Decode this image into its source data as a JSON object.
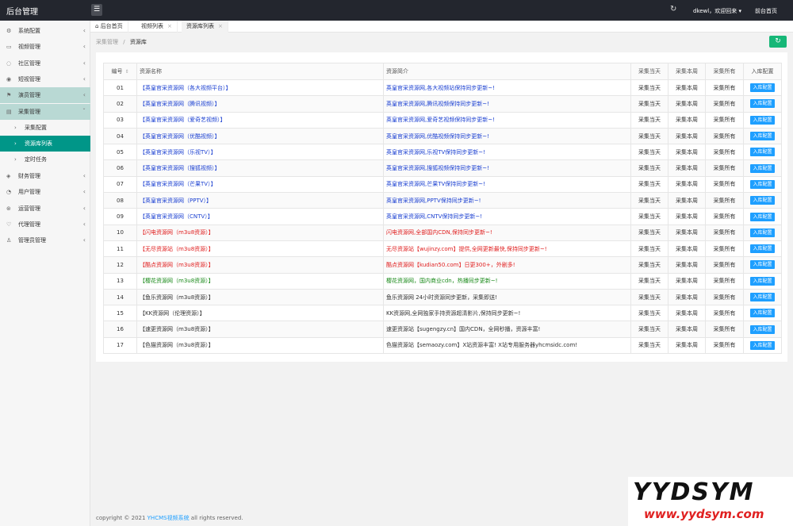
{
  "app": {
    "title": "后台管理"
  },
  "topbar": {
    "user": "dkewl，欢迎回来 ▾",
    "home_link": "前台首页"
  },
  "sidebar": {
    "items": [
      {
        "label": "系统配置",
        "icon": "gear-icon",
        "glyph": "⚙"
      },
      {
        "label": "视频管理",
        "icon": "video-icon",
        "glyph": "▭"
      },
      {
        "label": "社区管理",
        "icon": "community-icon",
        "glyph": "◌"
      },
      {
        "label": "短视管理",
        "icon": "play-icon",
        "glyph": "◉"
      },
      {
        "label": "演员管理",
        "icon": "flag-icon",
        "glyph": "⚑"
      },
      {
        "label": "采集管理",
        "icon": "collect-icon",
        "glyph": "▤"
      },
      {
        "label": "采集配置",
        "icon": "chevron-right-icon",
        "glyph": "›"
      },
      {
        "label": "资源库列表",
        "icon": "chevron-right-icon",
        "glyph": "›"
      },
      {
        "label": "定时任务",
        "icon": "chevron-right-icon",
        "glyph": "›"
      },
      {
        "label": "财务管理",
        "icon": "finance-icon",
        "glyph": "◈"
      },
      {
        "label": "用户管理",
        "icon": "user-icon",
        "glyph": "◔"
      },
      {
        "label": "运营管理",
        "icon": "operation-icon",
        "glyph": "⊛"
      },
      {
        "label": "代理管理",
        "icon": "agent-icon",
        "glyph": "♡"
      },
      {
        "label": "管理员管理",
        "icon": "admin-icon",
        "glyph": "♙"
      }
    ]
  },
  "tabs": [
    {
      "label": "后台首页",
      "icon": "home-icon"
    },
    {
      "label": "视频列表",
      "close": "×"
    },
    {
      "label": "资源库列表",
      "close": "×"
    }
  ],
  "breadcrumb": {
    "parent": "采集管理",
    "sep": "/",
    "current": "资源库"
  },
  "table": {
    "headers": [
      "编号",
      "资源名称",
      "资源简介",
      "采集当天",
      "采集本周",
      "采集所有",
      "入库配置"
    ],
    "action_day": "采集当天",
    "action_week": "采集本周",
    "action_all": "采集所有",
    "action_import": "入库配置",
    "rows": [
      {
        "id": "01",
        "name": "【英皇官采资源网（各大视频平台）】",
        "desc": "英皇官采资源网,各大视频站保持同步更新~!",
        "color": "#1a3fd1"
      },
      {
        "id": "02",
        "name": "【英皇官采资源网（腾讯视频）】",
        "desc": "英皇官采资源网,腾讯视频保持同步更新~!",
        "color": "#1a3fd1"
      },
      {
        "id": "03",
        "name": "【英皇官采资源网（爱奇艺视频）】",
        "desc": "英皇官采资源网,爱奇艺视频保持同步更新~!",
        "color": "#1a3fd1"
      },
      {
        "id": "04",
        "name": "【英皇官采资源网（优酷视频）】",
        "desc": "英皇官采资源网,优酷视频保持同步更新~!",
        "color": "#1a3fd1"
      },
      {
        "id": "05",
        "name": "【英皇官采资源网（乐视TV）】",
        "desc": "英皇官采资源网,乐视TV保持同步更新~!",
        "color": "#1a3fd1"
      },
      {
        "id": "06",
        "name": "【英皇官采资源网（搜狐视频）】",
        "desc": "英皇官采资源网,搜狐视频保持同步更新~!",
        "color": "#1a3fd1"
      },
      {
        "id": "07",
        "name": "【英皇官采资源网（芒果TV）】",
        "desc": "英皇官采资源网,芒果TV保持同步更新~!",
        "color": "#1a3fd1"
      },
      {
        "id": "08",
        "name": "【英皇官采资源网（PPTV）】",
        "desc": "英皇官采资源网,PPTV保持同步更新~!",
        "color": "#1a3fd1"
      },
      {
        "id": "09",
        "name": "【英皇官采资源网（CNTV）】",
        "desc": "英皇官采资源网,CNTV保持同步更新~!",
        "color": "#1a3fd1"
      },
      {
        "id": "10",
        "name": "【闪电资源网（m3u8资源）】",
        "desc": "闪电资源网,全部国内CDN,保持同步更新~!",
        "color": "#e02020"
      },
      {
        "id": "11",
        "name": "【无尽资源站（m3u8资源）】",
        "desc": "无尽资源站【wujinzy.com】提供,全网更新最快,保持同步更新~!",
        "color": "#e02020"
      },
      {
        "id": "12",
        "name": "【酷点资源网（m3u8资源）】",
        "desc": "酷点资源网【kudian50.com】日更300+，外剧多!",
        "color": "#e02020"
      },
      {
        "id": "13",
        "name": "【樱花资源网（m3u8资源）】",
        "desc": "樱花资源网，国内商业cdn，热播同步更新~!",
        "color": "#1a8a1a"
      },
      {
        "id": "14",
        "name": "【鱼乐资源网（m3u8资源）】",
        "desc": "鱼乐资源网 24小时资源同步更新，采集即送!",
        "color": "#333333"
      },
      {
        "id": "15",
        "name": "【KK资源网（伦理资源）】",
        "desc": "KK资源网,全网独家手持资源超清影片,保持同步更新~!",
        "color": "#333333"
      },
      {
        "id": "16",
        "name": "【速更资源网（m3u8资源）】",
        "desc": "速更资源站【sugengzy.cn】国内CDN，全网秒播，资源丰富!",
        "color": "#333333"
      },
      {
        "id": "17",
        "name": "【色猫资源网（m3u8资源）】",
        "desc": "色猫资源站【semaozy.com】X站资源丰富! X站专用服务器yhcmsidc.com!",
        "color": "#333333"
      }
    ]
  },
  "footer": {
    "prefix": "copyright © 2021 ",
    "link": "YHCMS视频系统",
    "suffix": " all rights reserved."
  },
  "watermark": {
    "big": "YYDSYM",
    "small": "www.yydsym.com"
  },
  "colors": {
    "topbar": "#23262e",
    "accent": "#009688",
    "button": "#1e9fff",
    "refresh": "#16b777"
  }
}
